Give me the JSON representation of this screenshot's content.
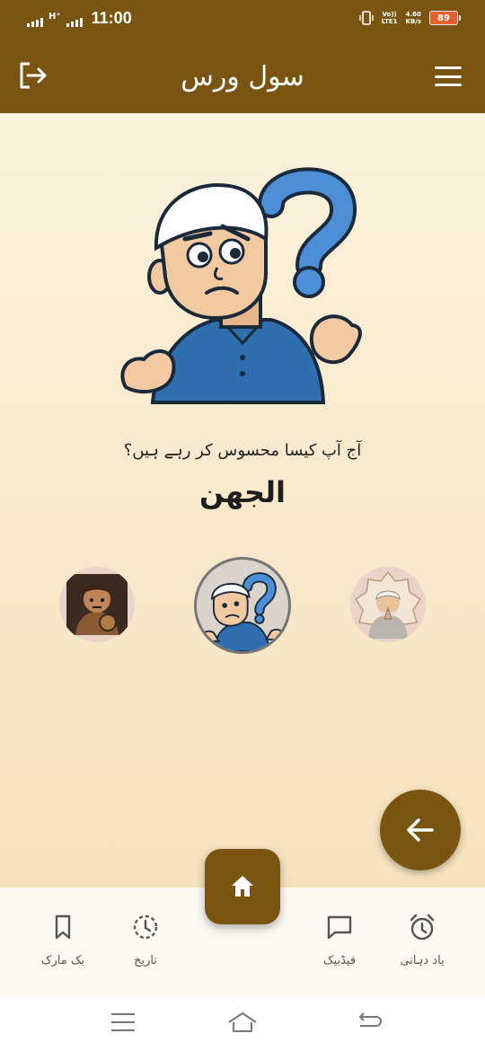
{
  "status_bar": {
    "network_type": "H⁺",
    "time": "11:00",
    "volte_line1": "Vo))",
    "volte_line2": "LTE1",
    "speed_value": "4.60",
    "speed_unit": "KB/s",
    "battery_level": "89",
    "battery_color": "#e45f2e"
  },
  "header": {
    "title": "سول ورس",
    "logout_icon": "logout-icon",
    "menu_icon": "hamburger-menu-icon",
    "background_color": "#7a5511"
  },
  "main": {
    "prompt": "آج آپ کیسا محسوس کر رہے ہیں؟",
    "current_mood": "الجھن",
    "hero_image": "confused-man-illustration",
    "mood_options": [
      {
        "name": "angry-boy-avatar",
        "selected": false
      },
      {
        "name": "confused-man-avatar",
        "selected": true
      },
      {
        "name": "praying-man-avatar",
        "selected": false
      }
    ],
    "back_fab_icon": "arrow-left-icon"
  },
  "bottom_nav": {
    "items": [
      {
        "label": "بک مارک",
        "icon": "bookmark-icon"
      },
      {
        "label": "تاریخ",
        "icon": "history-icon"
      },
      {
        "label": "فیڈبیک",
        "icon": "feedback-icon"
      },
      {
        "label": "یاد دہانی",
        "icon": "alarm-icon"
      }
    ],
    "home_icon": "home-icon"
  },
  "system_nav": {
    "icons": [
      "recent-apps-icon",
      "home-icon",
      "back-icon"
    ]
  }
}
